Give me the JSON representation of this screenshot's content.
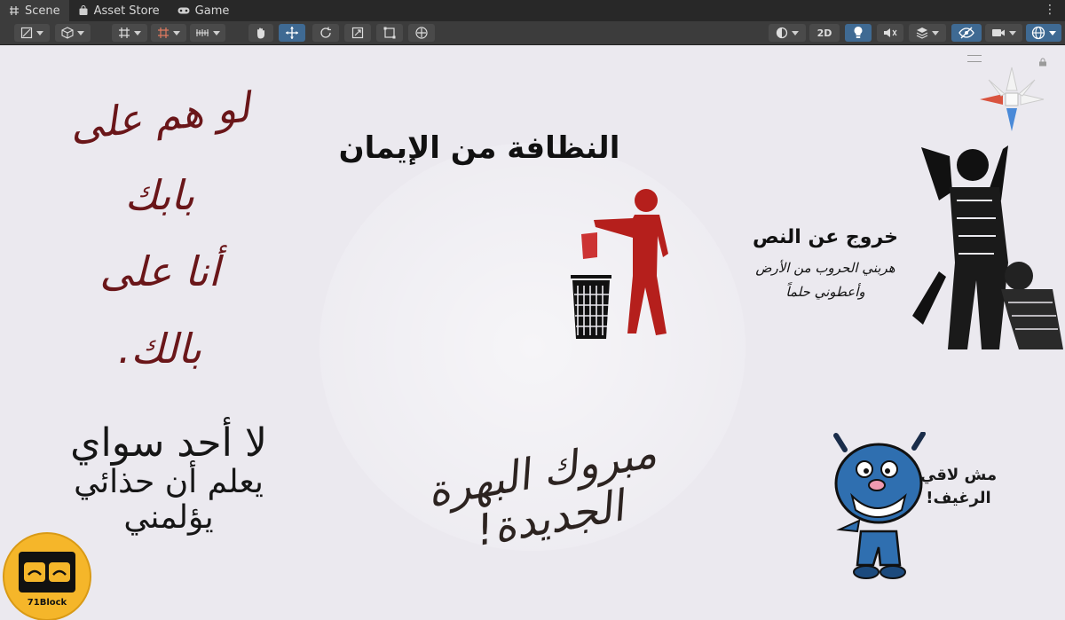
{
  "tabs": [
    {
      "label": "Scene",
      "icon": "grid-icon",
      "active": true
    },
    {
      "label": "Asset Store",
      "icon": "bag-icon",
      "active": false
    },
    {
      "label": "Game",
      "icon": "gamepad-icon",
      "active": false
    }
  ],
  "toolbar": {
    "view_2d_label": "2D"
  },
  "scene": {
    "poem_lines": [
      "لو هم على",
      "بابك",
      "أنا على",
      "بالك."
    ],
    "cleanliness_headline": "النظافة من الإيمان",
    "exit_text": {
      "title": "خروج عن النص",
      "line1": "هربني الحروب من الأرض",
      "line2": "وأعطوني حلماً"
    },
    "shoes_poem": [
      "لا أحد سواي",
      "يعلم أن حذائي",
      "يؤلمني"
    ],
    "congrats_text": "مبروك البهرة الجديدة!",
    "bread_text": [
      "مش لاقي",
      "الرغيف!"
    ]
  },
  "logo": {
    "label": "71Block"
  },
  "colors": {
    "tabbar_bg": "#282828",
    "toolbar_bg": "#3c3c3c",
    "active_tool": "#3f6a93",
    "scene_bg": "#ebe9ef",
    "poem_red": "#6a1619",
    "trash_red": "#b51f1c",
    "monster_blue": "#2f6fb0",
    "logo_yellow": "#f5b62a"
  }
}
